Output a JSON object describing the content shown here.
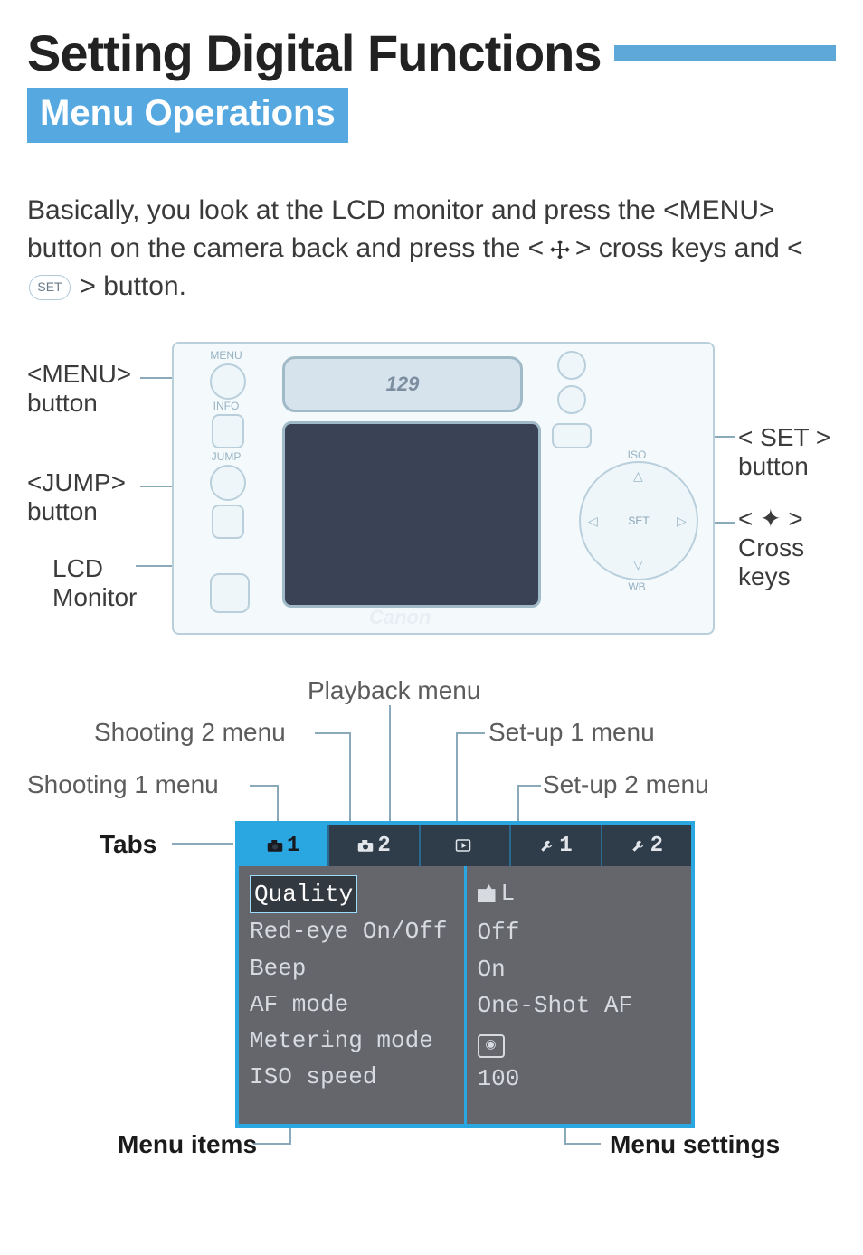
{
  "heading": "Setting Digital Functions",
  "subheading": "Menu Operations",
  "intro_pre": "Basically, you look at the LCD monitor and press the <",
  "intro_menu": "MENU",
  "intro_mid1": "> button on the camera back and press the < ",
  "intro_mid2": " > cross keys and < ",
  "intro_set": "SET",
  "intro_end": " > button.",
  "camera_labels": {
    "menu_btn": "<MENU>\nbutton",
    "jump_btn": "<JUMP>\nbutton",
    "lcd_monitor": "LCD\nMonitor",
    "set_btn": "< SET >\nbutton",
    "cross_keys": "< ✦ >\nCross\nkeys"
  },
  "camera_small": {
    "menu": "MENU",
    "info": "INFO",
    "jump": "JUMP",
    "iso": "ISO",
    "wb": "WB"
  },
  "lcd_top_text": "129",
  "brand": "Canon",
  "menu_labels": {
    "playback": "Playback menu",
    "shooting2": "Shooting 2 menu",
    "setup1": "Set-up 1 menu",
    "shooting1": "Shooting 1 menu",
    "setup2": "Set-up 2 menu",
    "tabs": "Tabs",
    "menu_items": "Menu items",
    "menu_settings": "Menu settings"
  },
  "tabs": [
    {
      "num": "1",
      "kind": "camera",
      "selected": true
    },
    {
      "num": "2",
      "kind": "camera",
      "selected": false
    },
    {
      "num": "",
      "kind": "play",
      "selected": false
    },
    {
      "num": "1",
      "kind": "wrench",
      "selected": false
    },
    {
      "num": "2",
      "kind": "wrench",
      "selected": false
    }
  ],
  "menu_items": [
    {
      "label": "Quality",
      "value_kind": "quality",
      "value": "L",
      "selected": true
    },
    {
      "label": "Red-eye On/Off",
      "value_kind": "text",
      "value": "Off"
    },
    {
      "label": "Beep",
      "value_kind": "text",
      "value": "On"
    },
    {
      "label": "AF mode",
      "value_kind": "text",
      "value": "One-Shot AF"
    },
    {
      "label": "Metering mode",
      "value_kind": "eval",
      "value": ""
    },
    {
      "label": "ISO speed",
      "value_kind": "text",
      "value": "100"
    }
  ]
}
